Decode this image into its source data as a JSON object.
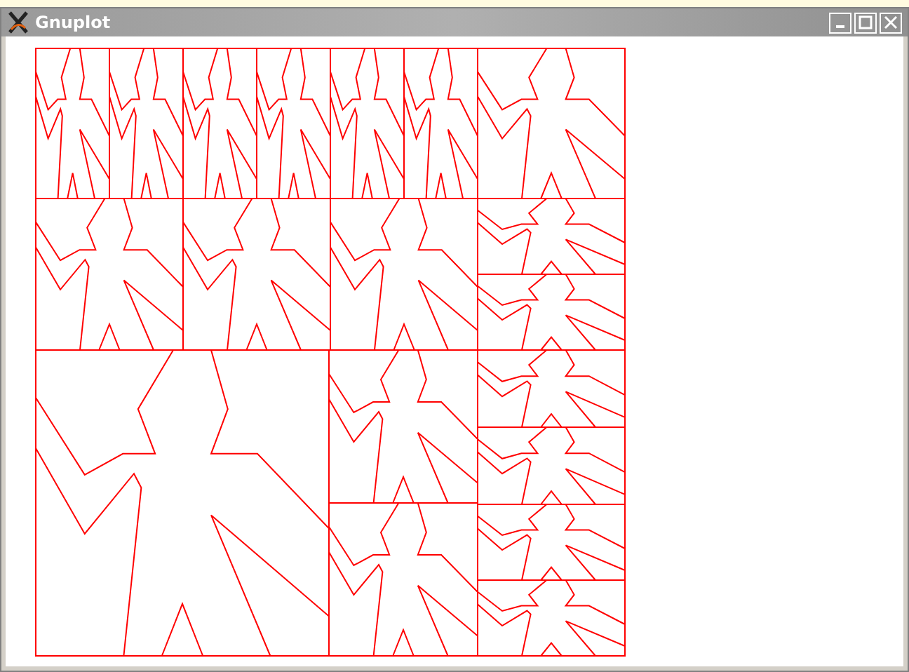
{
  "window": {
    "title": "Gnuplot"
  }
}
